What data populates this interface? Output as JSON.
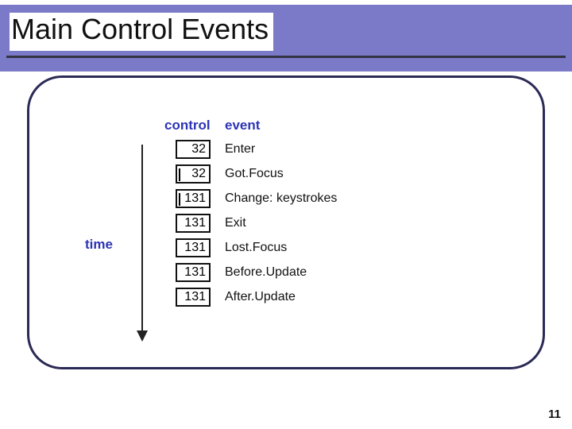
{
  "title": "Main Control Events",
  "headers": {
    "control": "control",
    "event": "event"
  },
  "time_label": "time",
  "rows": [
    {
      "control": "32",
      "event": "Enter",
      "caret": false
    },
    {
      "control": "32",
      "event": "Got.Focus",
      "caret": true
    },
    {
      "control": "131",
      "event": "Change: keystrokes",
      "caret": true
    },
    {
      "control": "131",
      "event": "Exit",
      "caret": false
    },
    {
      "control": "131",
      "event": "Lost.Focus",
      "caret": false
    },
    {
      "control": "131",
      "event": "Before.Update",
      "caret": false
    },
    {
      "control": "131",
      "event": "After.Update",
      "caret": false
    }
  ],
  "page_number": "11"
}
